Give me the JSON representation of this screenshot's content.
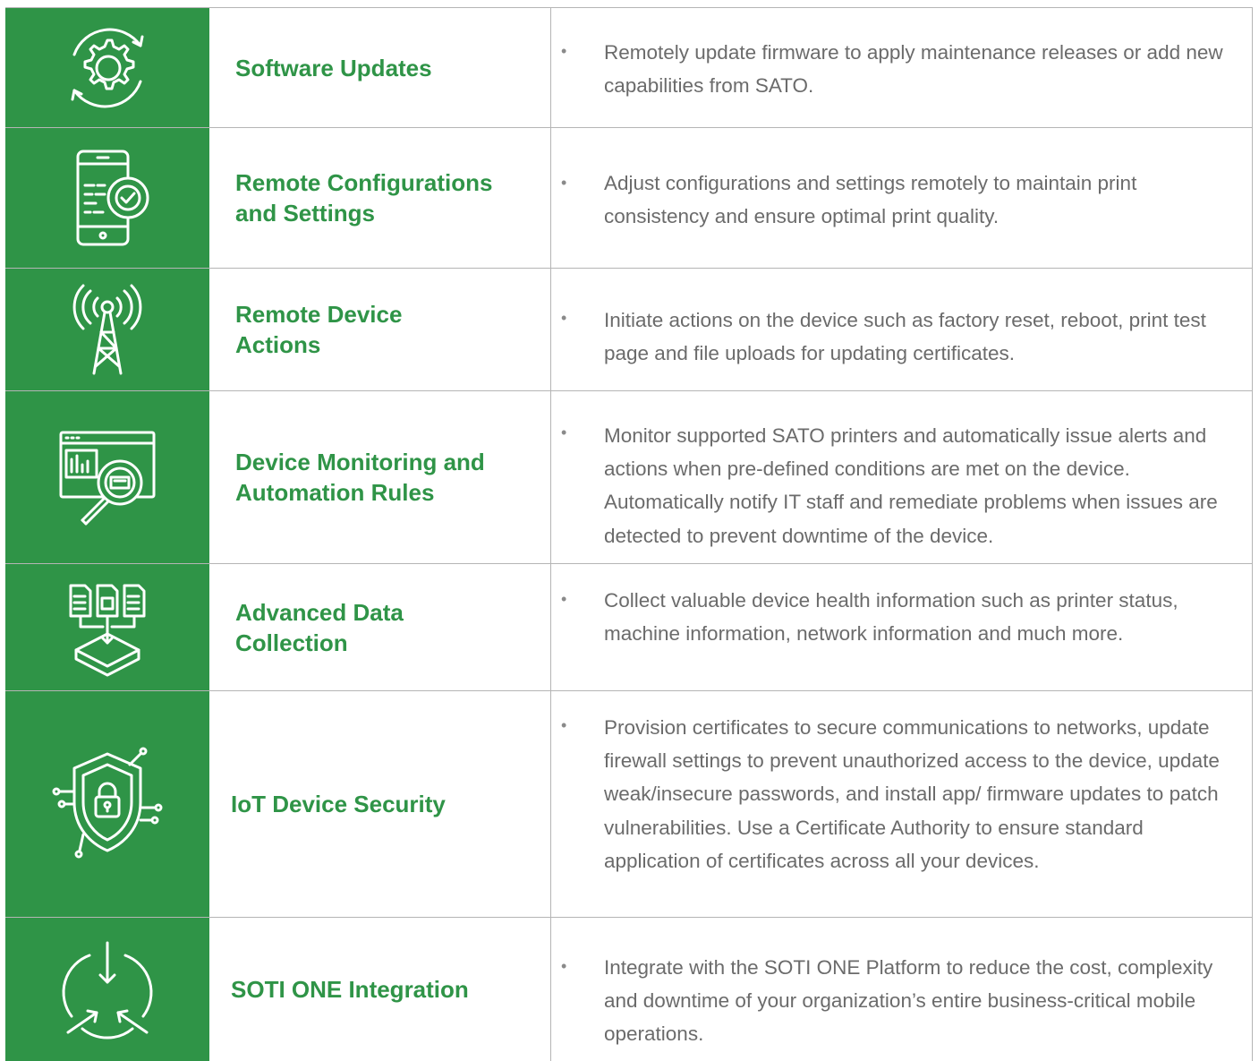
{
  "bullet_char": "•",
  "features": [
    {
      "icon": "gear-update-icon",
      "title": "Software Updates",
      "description": "Remotely update firmware to apply maintenance releases or add new capabilities from SATO."
    },
    {
      "icon": "phone-settings-icon",
      "title": "Remote Configurations and Settings",
      "description": "Adjust configurations and settings remotely to maintain print consistency and ensure optimal print quality."
    },
    {
      "icon": "antenna-tower-icon",
      "title": "Remote Device Actions",
      "description": "Initiate actions on the device such as factory reset, reboot, print test page and file uploads for updating certificates."
    },
    {
      "icon": "monitoring-magnifier-icon",
      "title": "Device Monitoring and Automation Rules",
      "description": "Monitor supported SATO printers and automatically issue alerts and actions when pre-defined conditions are met on the device. Automatically notify IT staff and remediate problems when issues are detected to prevent downtime of the device."
    },
    {
      "icon": "data-collection-icon",
      "title": "Advanced Data Collection",
      "description": "Collect valuable device health information such as printer status, machine information, network information and much more."
    },
    {
      "icon": "shield-lock-icon",
      "title": "IoT Device Security",
      "description": "Provision certificates to secure communications to networks, update firewall settings to prevent unauthorized access to the device, update weak/insecure passwords, and install app/ firmware updates to patch vulnerabilities. Use a Certificate Authority to ensure standard application of certificates across all your devices."
    },
    {
      "icon": "integration-arrows-icon",
      "title": "SOTI ONE Integration",
      "description": "Integrate with the SOTI ONE Platform to reduce the cost, complexity and downtime of your organization’s entire business-critical mobile operations."
    }
  ],
  "colors": {
    "brand_green": "#2f9447",
    "text_gray": "#6b6b6b",
    "border": "#b5b5b5"
  }
}
